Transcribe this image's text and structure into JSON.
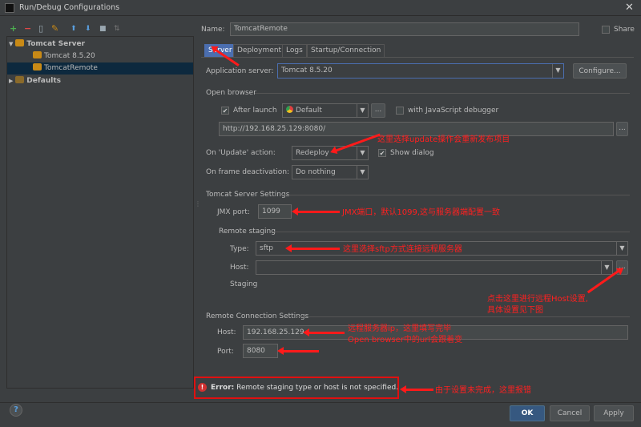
{
  "window": {
    "title": "Run/Debug Configurations",
    "close_glyph": "✕"
  },
  "toolbar": {
    "icons": [
      "add-icon",
      "remove-icon",
      "copy-icon",
      "wrench-icon",
      "move-up-icon",
      "move-down-icon",
      "folder-icon",
      "sort-icon"
    ],
    "glyphs": [
      "+",
      "−",
      "▯",
      "✎",
      "⬆",
      "⬇",
      "■",
      "⇅"
    ]
  },
  "tree": {
    "group_label": "Tomcat Server",
    "items": [
      "Tomcat 8.5.20",
      "TomcatRemote"
    ],
    "defaults_label": "Defaults",
    "expand_glyph": "▼",
    "collapse_glyph": "▶"
  },
  "name_row": {
    "label": "Name:",
    "value": "TomcatRemote",
    "share_label": "Share"
  },
  "tabs": [
    "Server",
    "Deployment",
    "Logs",
    "Startup/Connection"
  ],
  "server": {
    "app_server_label": "Application server:",
    "app_server_value": "Tomcat 8.5.20",
    "configure_label": "Configure...",
    "open_browser_label": "Open browser",
    "after_launch_label": "After launch",
    "browser_value": "Default",
    "dots": "...",
    "js_debugger_label": "with JavaScript debugger",
    "url_value": "http://192.168.25.129:8080/",
    "update_label": "On 'Update' action:",
    "update_value": "Redeploy",
    "show_dialog_label": "Show dialog",
    "frame_label": "On frame deactivation:",
    "frame_value": "Do nothing",
    "tomcat_settings_label": "Tomcat Server Settings",
    "jmx_label": "JMX port:",
    "jmx_value": "1099",
    "remote_staging_label": "Remote staging",
    "type_label": "Type:",
    "type_value": "sftp",
    "host_label": "Host:",
    "host_value": "",
    "staging_label": "Staging",
    "remote_conn_label": "Remote Connection Settings",
    "rc_host_label": "Host:",
    "rc_host_value": "192.168.25.129",
    "port_label": "Port:",
    "port_value": "8080"
  },
  "error": {
    "prefix": "Error:",
    "message": "Remote staging type or host is not specified.",
    "icon_glyph": "!"
  },
  "buttons": {
    "help_glyph": "?",
    "ok": "OK",
    "cancel": "Cancel",
    "apply": "Apply"
  },
  "annotations": {
    "update": "这里选择update操作会重新发布项目",
    "jmx": "JMX端口，默认1099,这与服务器端配置一致",
    "sftp": "这里选择sftp方式连接远程服务器",
    "host_line1": "点击这里进行远程Host设置,",
    "host_line2": "具体设置见下图",
    "ip_line1": "远程服务器ip，这里填写完毕",
    "ip_line2": "Open browser中的url会跟着变",
    "error": "由于设置未完成，这里报错"
  },
  "colors": {
    "accent": "#4b6eaf",
    "annotation": "#ff1a1a",
    "background": "#3c3f41"
  }
}
